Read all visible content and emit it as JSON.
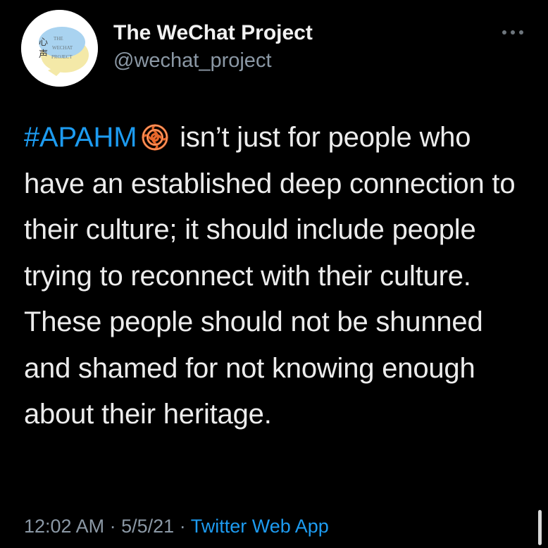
{
  "author": {
    "display_name": "The WeChat Project",
    "handle": "@wechat_project",
    "avatar_glyphs": "心声",
    "avatar_words": [
      "THE",
      "WECHAT",
      "PROJECT"
    ]
  },
  "tweet": {
    "hashtag": "#APAHM",
    "emoji": "chinese-knot-emoji",
    "text_after_hashtag": "isn’t just for people who have an established deep connection to their culture; it should include people trying to reconnect with their culture. These people should not be shunned and shamed for not knowing enough about their heritage.",
    "time": "12:02 AM",
    "separator": "·",
    "date": "5/5/21",
    "source": "Twitter Web App"
  },
  "colors": {
    "background": "#000000",
    "link": "#1d9bf0",
    "secondary": "#8b98a5",
    "knot": "#e8672a"
  },
  "icons": {
    "more": "more-horizontal-icon"
  }
}
